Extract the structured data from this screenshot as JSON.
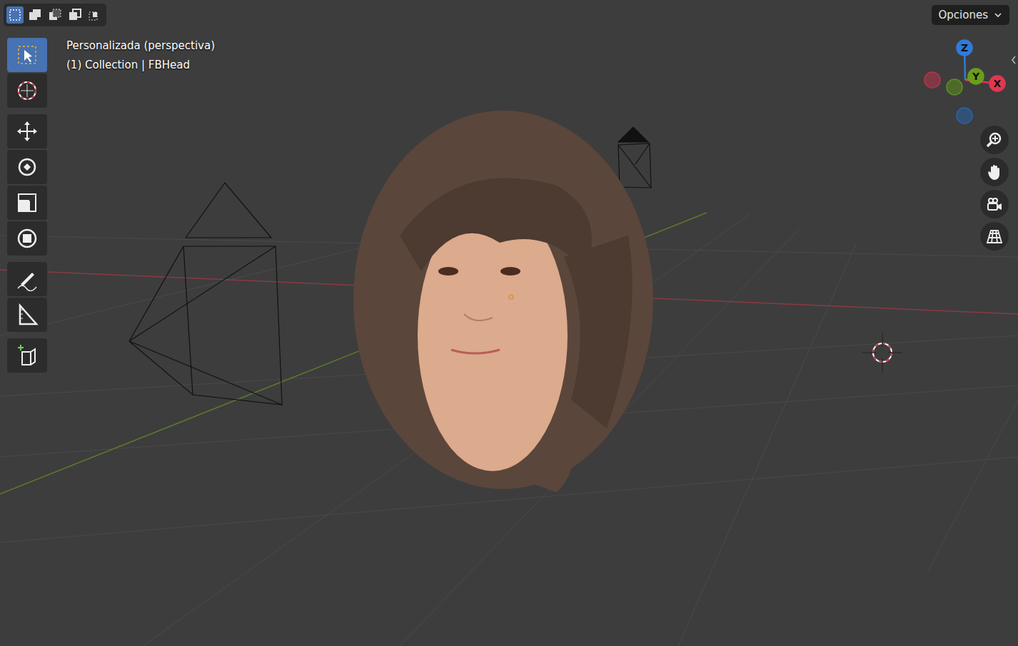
{
  "header": {
    "selection_modes": [
      {
        "kind": "new",
        "selected": true
      },
      {
        "kind": "extend",
        "selected": false
      },
      {
        "kind": "subtract",
        "selected": false
      },
      {
        "kind": "difference",
        "selected": false
      },
      {
        "kind": "intersect",
        "selected": false
      }
    ],
    "options_label": "Opciones"
  },
  "viewport": {
    "view_name": "Personalizada (perspectiva)",
    "context": "(1) Collection | FBHead"
  },
  "toolbar": {
    "groups": [
      [
        {
          "kind": "select",
          "selected": true
        },
        {
          "kind": "cursor",
          "selected": false
        }
      ],
      [
        {
          "kind": "move",
          "selected": false
        },
        {
          "kind": "rotate",
          "selected": false
        },
        {
          "kind": "scale",
          "selected": false
        },
        {
          "kind": "transform",
          "selected": false
        }
      ],
      [
        {
          "kind": "annotate",
          "selected": false
        },
        {
          "kind": "measure",
          "selected": false
        }
      ],
      [
        {
          "kind": "add-cube",
          "selected": false
        }
      ]
    ]
  },
  "gizmo": {
    "axes": [
      {
        "kind": "positive",
        "label": "Z",
        "color": "#2f7bd8"
      },
      {
        "kind": "positive",
        "label": "Y",
        "color": "#6b9d1c"
      },
      {
        "kind": "positive",
        "label": "X",
        "color": "#e23751"
      },
      {
        "kind": "negative",
        "color": "#b8344a"
      },
      {
        "kind": "negative",
        "color": "#5c8f1d"
      },
      {
        "kind": "negative",
        "color": "#2a63aa"
      }
    ]
  },
  "nav_buttons": [
    {
      "kind": "zoom"
    },
    {
      "kind": "pan"
    },
    {
      "kind": "camera"
    },
    {
      "kind": "perspective"
    }
  ]
}
